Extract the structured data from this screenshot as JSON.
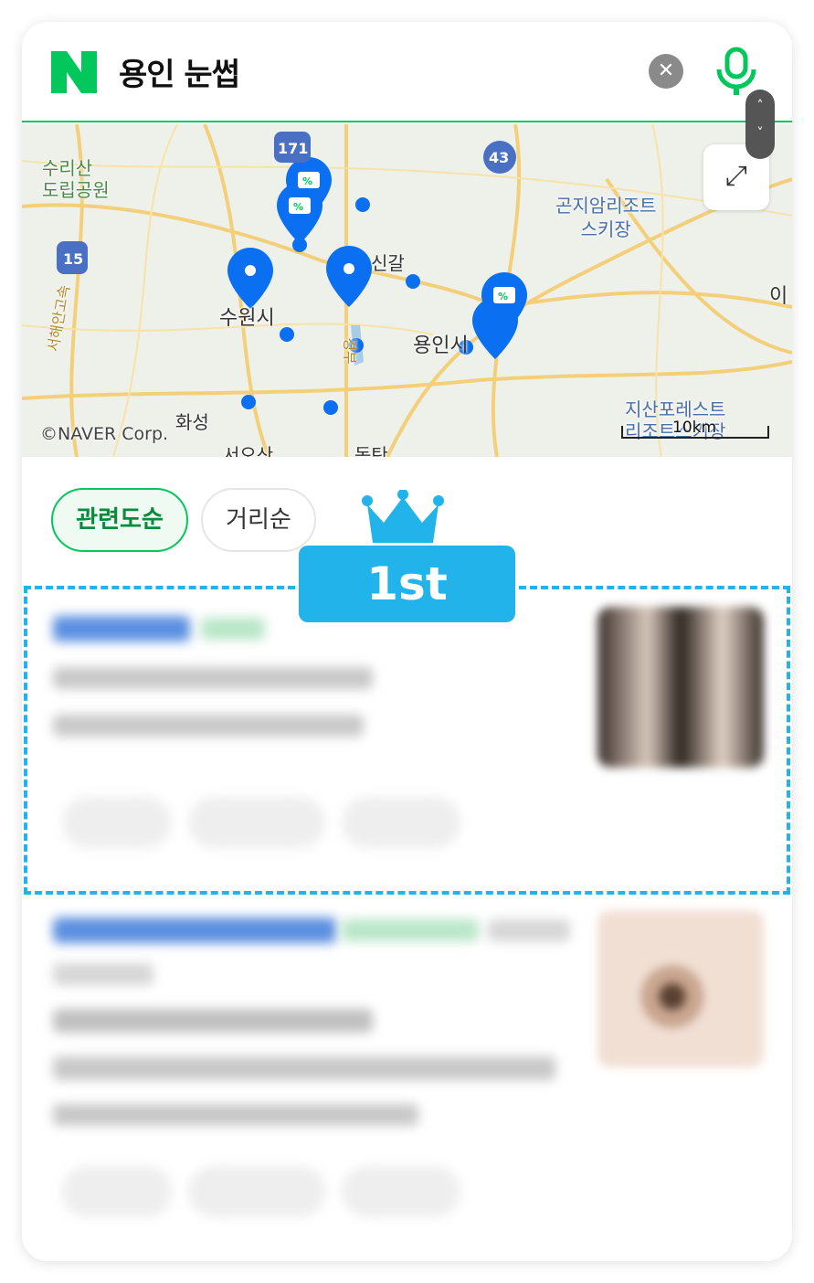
{
  "search": {
    "query": "용인 눈썹",
    "logo": "N",
    "clear_icon": "close-icon",
    "mic_icon": "mic-icon"
  },
  "map": {
    "labels": [
      "수리산\n도립공원",
      "곤지암리조트\n스키장",
      "수원시",
      "신갈",
      "용인시",
      "화성",
      "지산포레스트\n리조트스키장",
      "이",
      "서오산",
      "동탄",
      "서해안고속",
      "경부"
    ],
    "highway_shields": [
      "171",
      "15",
      "43"
    ],
    "copyright": "©NAVER Corp.",
    "scale": "10km",
    "accent": "#0068f0"
  },
  "sort": {
    "options": [
      {
        "label": "관련도순",
        "selected": true
      },
      {
        "label": "거리순",
        "selected": false
      }
    ]
  },
  "highlight": {
    "rank_label": "1st",
    "color": "#22b3ea"
  },
  "colors": {
    "brand": "#03c75a",
    "marker": "#0a6ff0"
  }
}
